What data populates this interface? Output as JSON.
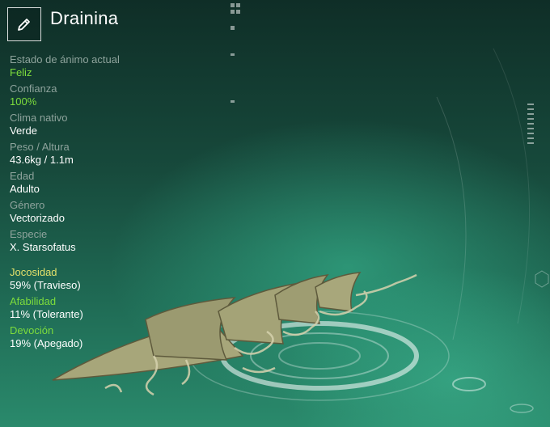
{
  "creature": {
    "name": "Drainina"
  },
  "icons": {
    "edit": "pencil-icon"
  },
  "stats": [
    {
      "label": "Estado de ánimo actual",
      "value": "Feliz",
      "highlight": true
    },
    {
      "label": "Confianza",
      "value": "100%",
      "highlight": true
    },
    {
      "label": "Clima nativo",
      "value": "Verde",
      "highlight": false
    },
    {
      "label": "Peso / Altura",
      "value": "43.6kg / 1.1m",
      "highlight": false
    },
    {
      "label": "Edad",
      "value": "Adulto",
      "highlight": false
    },
    {
      "label": "Género",
      "value": "Vectorizado",
      "highlight": false
    },
    {
      "label": "Especie",
      "value": "X. Starsofatus",
      "highlight": false
    }
  ],
  "traits": [
    {
      "label": "Jocosidad",
      "value": "59% (Travieso)",
      "color": "#e3e06a"
    },
    {
      "label": "Afabilidad",
      "value": "11% (Tolerante)",
      "color": "#7ddc3c"
    },
    {
      "label": "Devoción",
      "value": "19% (Apegado)",
      "color": "#7ddc3c"
    }
  ],
  "colors": {
    "accent_green": "#7ddc3c",
    "accent_yellow": "#e3e06a",
    "label_gray": "#8ea39c",
    "background_teal": "#1f6a54"
  }
}
